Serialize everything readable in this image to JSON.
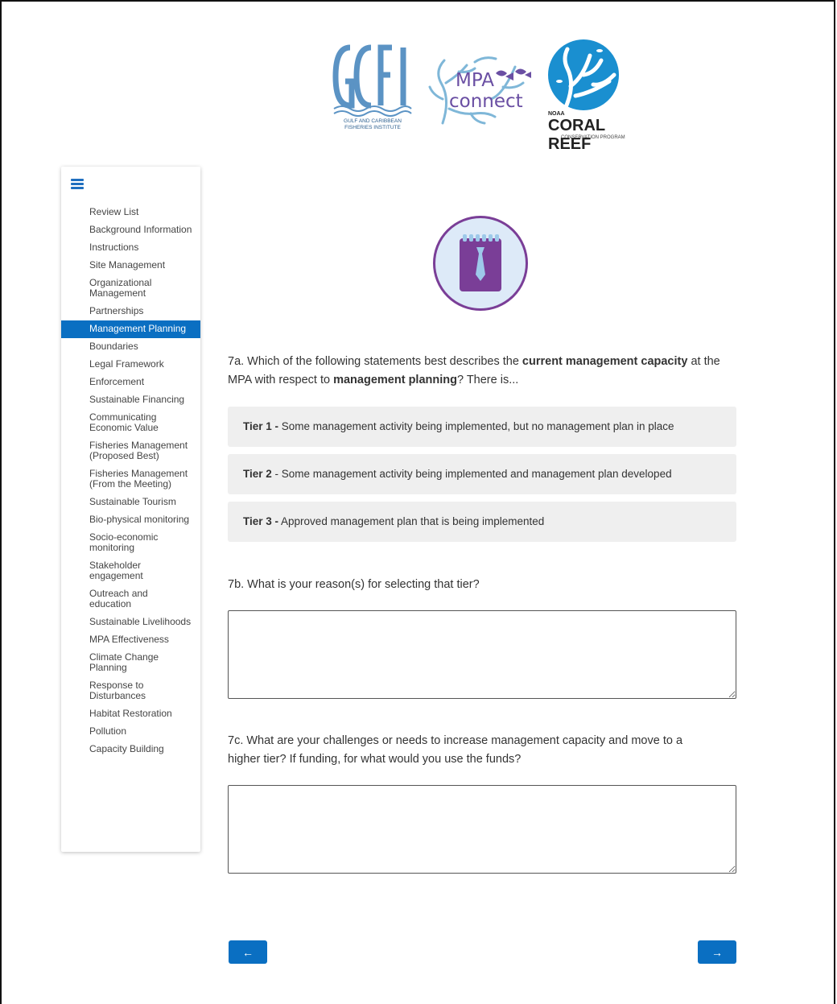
{
  "logos": {
    "gcfi_letters": "GCFI",
    "gcfi_caption_line1": "GULF AND CARIBBEAN",
    "gcfi_caption_line2": "FISHERIES INSTITUTE",
    "mpa_line1": "MPA",
    "mpa_line2": "connect",
    "coral_noaa": "NOAA",
    "coral_title": "CORAL REEF",
    "coral_sub": "CONSERVATION PROGRAM"
  },
  "sidebar": {
    "items": [
      {
        "label": "Review List"
      },
      {
        "label": "Background Information"
      },
      {
        "label": "Instructions"
      },
      {
        "label": "Site Management"
      },
      {
        "label": "Organizational Management"
      },
      {
        "label": "Partnerships"
      },
      {
        "label": "Management Planning",
        "active": true
      },
      {
        "label": "Boundaries"
      },
      {
        "label": "Legal Framework"
      },
      {
        "label": "Enforcement"
      },
      {
        "label": "Sustainable Financing"
      },
      {
        "label": "Communicating Economic Value"
      },
      {
        "label": "Fisheries Management (Proposed Best)"
      },
      {
        "label": "Fisheries Management (From the Meeting)"
      },
      {
        "label": "Sustainable Tourism"
      },
      {
        "label": "Bio-physical monitoring"
      },
      {
        "label": "Socio-economic monitoring"
      },
      {
        "label": "Stakeholder engagement"
      },
      {
        "label": "Outreach and education"
      },
      {
        "label": "Sustainable Livelihoods"
      },
      {
        "label": "MPA Effectiveness"
      },
      {
        "label": "Climate Change Planning"
      },
      {
        "label": "Response to Disturbances"
      },
      {
        "label": "Habitat Restoration"
      },
      {
        "label": "Pollution"
      },
      {
        "label": "Capacity Building"
      }
    ]
  },
  "questions": {
    "q7a_part1": "7a. Which of the following statements best describes the ",
    "q7a_bold1": "current management capacity",
    "q7a_part2": " at the MPA with respect to ",
    "q7a_bold2": "management planning",
    "q7a_part3": "?  There is...",
    "tiers": [
      {
        "label": "Tier 1 -",
        "text": " Some management activity being implemented, but no management plan in place"
      },
      {
        "label": "Tier 2",
        "text": " - Some management activity being implemented and management plan developed"
      },
      {
        "label": "Tier 3 -",
        "text": " Approved management plan that is being implemented"
      }
    ],
    "q7b": "7b. What is your reason(s) for selecting that tier?",
    "q7c_line1": "7c. What are your challenges or needs to increase management capacity and move to a",
    "q7c_line2": "higher tier?  If funding, for what would you use the funds?",
    "q7b_value": "",
    "q7c_value": ""
  },
  "navigation": {
    "prev_label": "←",
    "next_label": "→"
  },
  "colors": {
    "accent": "#0a6fc2",
    "hero_ring": "#7a3e97",
    "hero_fill": "#ddeaf8",
    "tier_bg": "#efefef"
  }
}
